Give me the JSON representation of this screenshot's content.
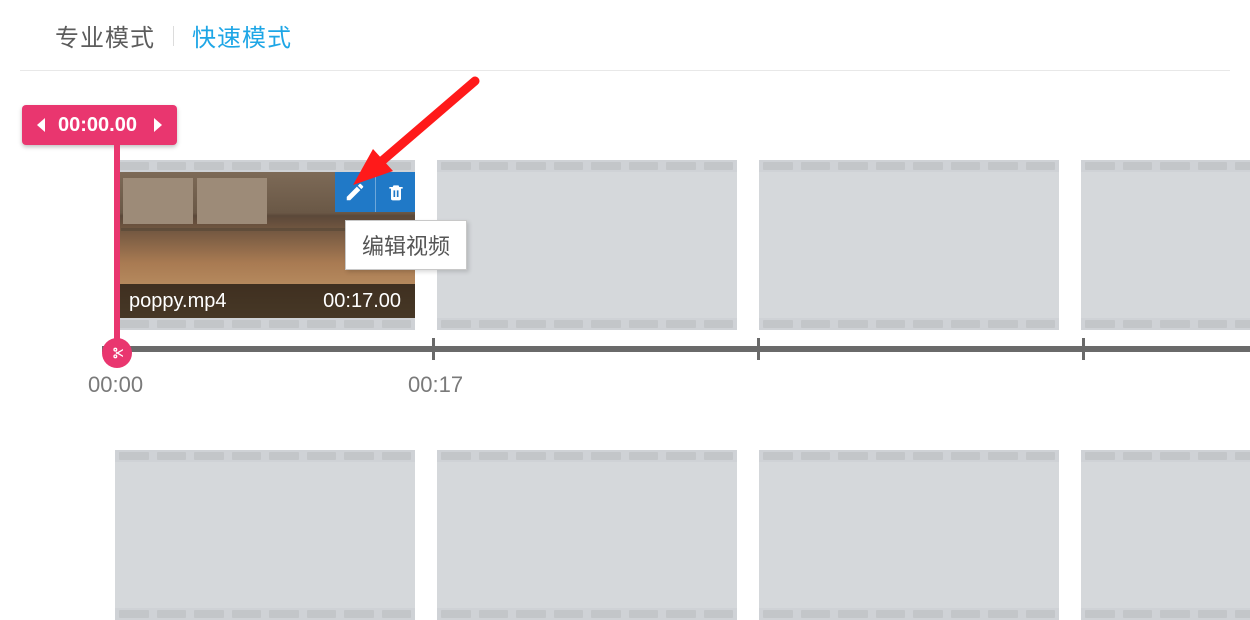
{
  "modes": {
    "pro": "专业模式",
    "quick": "快速模式",
    "active": "pro"
  },
  "playhead": {
    "time": "00:00.00"
  },
  "clip": {
    "filename": "poppy.mp4",
    "duration": "00:17.00"
  },
  "tooltip": {
    "edit_video": "编辑视频"
  },
  "ruler": {
    "t0": "00:00",
    "t1": "00:17"
  },
  "icons": {
    "prev": "prev-frame",
    "next": "next-frame",
    "edit": "pencil",
    "delete": "trash",
    "scissors": "scissors"
  }
}
